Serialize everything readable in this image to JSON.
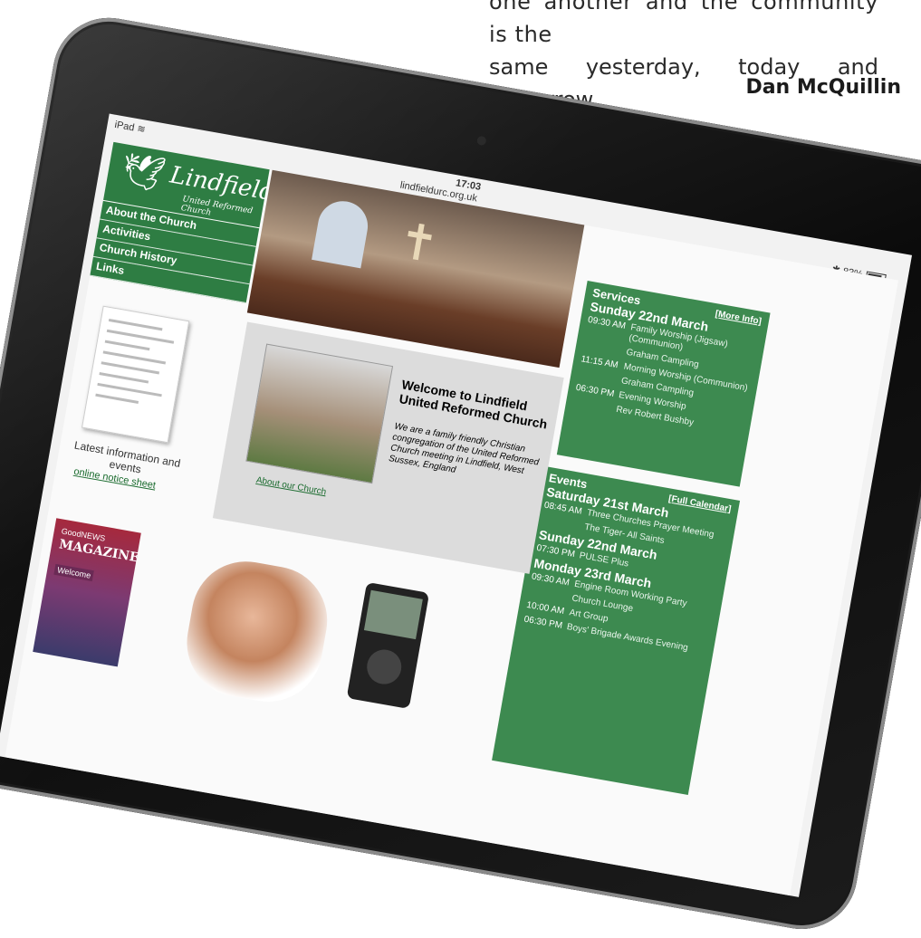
{
  "quote": {
    "line1": "one another and the community is the",
    "line2": "same yesterday, today and tomorrow.",
    "author": "Dan McQuillin"
  },
  "status_bar": {
    "device": "iPad",
    "time": "17:03",
    "url": "lindfieldurc.org.uk",
    "battery": "83%"
  },
  "site": {
    "logo_name": "Lindfield",
    "logo_sub": "United Reformed Church",
    "nav": [
      "About the Church",
      "Activities",
      "Church History",
      "Links"
    ],
    "services": {
      "title": "Services",
      "more": "[More Info]",
      "day": "Sunday 22nd March",
      "rows": [
        {
          "time": "09:30 AM",
          "desc": "Family Worship (Jigsaw) (Communion)"
        },
        {
          "time": "",
          "desc": "Graham Campling"
        },
        {
          "time": "11:15 AM",
          "desc": "Morning Worship (Communion)"
        },
        {
          "time": "",
          "desc": "Graham Campling"
        },
        {
          "time": "06:30 PM",
          "desc": "Evening Worship"
        },
        {
          "time": "",
          "desc": "Rev Robert Bushby"
        }
      ]
    },
    "events": {
      "title": "Events",
      "calendar": "[Full Calendar]",
      "days": [
        {
          "day": "Saturday 21st March",
          "rows": [
            {
              "time": "08:45 AM",
              "desc": "Three Churches Prayer Meeting"
            },
            {
              "time": "",
              "desc": "The Tiger- All Saints"
            }
          ]
        },
        {
          "day": "Sunday 22nd March",
          "rows": [
            {
              "time": "07:30 PM",
              "desc": "PULSE Plus"
            }
          ]
        },
        {
          "day": "Monday 23rd March",
          "rows": [
            {
              "time": "09:30 AM",
              "desc": "Engine Room Working Party"
            },
            {
              "time": "",
              "desc": "Church Lounge"
            },
            {
              "time": "10:00 AM",
              "desc": "Art Group"
            },
            {
              "time": "06:30 PM",
              "desc": "Boys' Brigade Awards Evening"
            }
          ]
        }
      ]
    },
    "welcome": {
      "heading": "Welcome to Lindfield United Reformed Church",
      "body": "We are a family friendly Christian congregation of the United Reformed Church meeting in Lindfield, West Sussex, England",
      "link": "About our Church"
    },
    "notice": {
      "caption": "Latest information and events",
      "link": "online notice sheet"
    },
    "magazine": {
      "top": "GoodNEWS",
      "title": "MAGAZINE",
      "label": "Welcome"
    }
  }
}
